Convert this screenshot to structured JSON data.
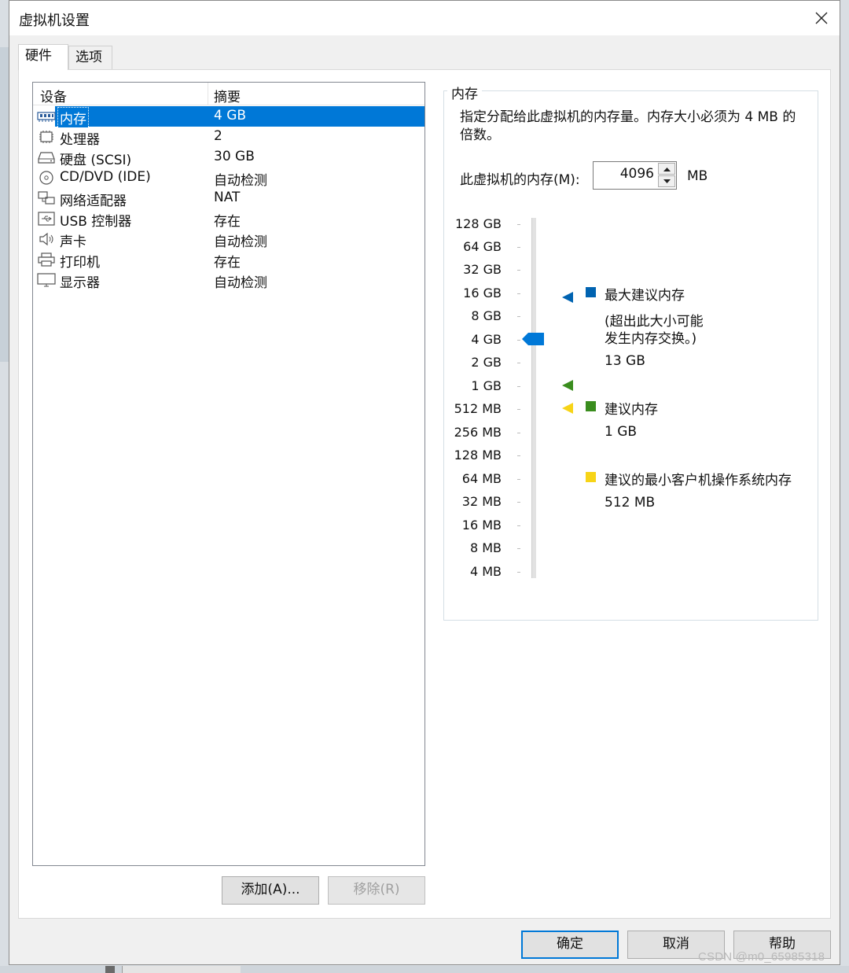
{
  "window": {
    "title": "虚拟机设置"
  },
  "tabs": [
    {
      "label": "硬件"
    },
    {
      "label": "选项"
    }
  ],
  "device_list": {
    "headers": {
      "device": "设备",
      "summary": "摘要"
    },
    "rows": [
      {
        "icon": "memory-icon",
        "name": "内存",
        "summary": "4 GB"
      },
      {
        "icon": "processor-icon",
        "name": "处理器",
        "summary": "2"
      },
      {
        "icon": "hard-disk-icon",
        "name": "硬盘 (SCSI)",
        "summary": "30 GB"
      },
      {
        "icon": "cd-dvd-icon",
        "name": "CD/DVD (IDE)",
        "summary": "自动检测"
      },
      {
        "icon": "network-adapter-icon",
        "name": "网络适配器",
        "summary": "NAT"
      },
      {
        "icon": "usb-icon",
        "name": "USB 控制器",
        "summary": "存在"
      },
      {
        "icon": "sound-card-icon",
        "name": "声卡",
        "summary": "自动检测"
      },
      {
        "icon": "printer-icon",
        "name": "打印机",
        "summary": "存在"
      },
      {
        "icon": "display-icon",
        "name": "显示器",
        "summary": "自动检测"
      }
    ],
    "selected": "内存"
  },
  "list_buttons": {
    "add": "添加(A)...",
    "remove": "移除(R)"
  },
  "memory": {
    "group_title": "内存",
    "description": "指定分配给此虚拟机的内存量。内存大小必须为 4 MB 的倍数。",
    "label": "此虚拟机的内存(M):",
    "value": "4096",
    "unit": "MB",
    "scale": [
      "128 GB",
      "64 GB",
      "32 GB",
      "16 GB",
      "8 GB",
      "4 GB",
      "2 GB",
      "1 GB",
      "512 MB",
      "256 MB",
      "128 MB",
      "64 MB",
      "32 MB",
      "16 MB",
      "8 MB",
      "4 MB"
    ],
    "current_level": "4 GB",
    "legend": {
      "max": {
        "title": "最大建议内存",
        "note_line1": "(超出此大小可能",
        "note_line2": "发生内存交换。)",
        "value": "13 GB",
        "color": "#0063b1"
      },
      "recommended": {
        "title": "建议内存",
        "value": "1 GB",
        "color": "#3a8d1e"
      },
      "min_guest": {
        "title": "建议的最小客户机操作系统内存",
        "value": "512 MB",
        "color": "#f7d417"
      }
    }
  },
  "footer_buttons": {
    "ok": "确定",
    "cancel": "取消",
    "help": "帮助"
  },
  "watermark": "CSDN @m0_65985318",
  "colors": {
    "selection": "#0078d7",
    "slider_thumb": "#0078d7"
  }
}
